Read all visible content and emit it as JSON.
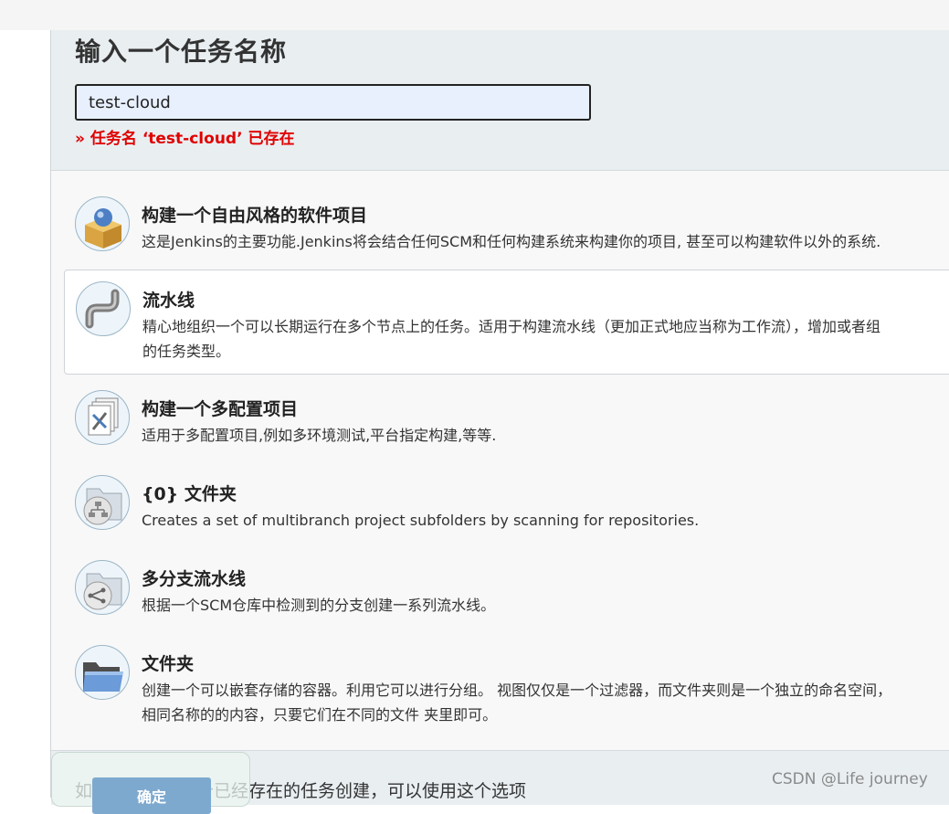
{
  "form": {
    "title": "输入一个任务名称",
    "name_value": "test-cloud",
    "error": "» 任务名 ‘test-cloud’ 已存在"
  },
  "item_types": [
    {
      "label": "构建一个自由风格的软件项目",
      "desc_lines": [
        "这是Jenkins的主要功能.Jenkins将会结合任何SCM和任何构建系统来构建你的项目, 甚至可以构建软件以外的系统."
      ],
      "icon": "freestyle-project-icon"
    },
    {
      "label": "流水线",
      "desc_lines": [
        "精心地组织一个可以长期运行在多个节点上的任务。适用于构建流水线（更加正式地应当称为工作流），增加或者组",
        "的任务类型。"
      ],
      "icon": "pipeline-icon",
      "selected": true
    },
    {
      "label": "构建一个多配置项目",
      "desc_lines": [
        "适用于多配置项目,例如多环境测试,平台指定构建,等等."
      ],
      "icon": "multi-config-project-icon"
    },
    {
      "label": "{0} 文件夹",
      "desc_lines": [
        "Creates a set of multibranch project subfolders by scanning for repositories."
      ],
      "icon": "org-folder-icon"
    },
    {
      "label": "多分支流水线",
      "desc_lines": [
        "根据一个SCM仓库中检测到的分支创建一系列流水线。"
      ],
      "icon": "multibranch-pipeline-icon"
    },
    {
      "label": "文件夹",
      "desc_lines": [
        "创建一个可以嵌套存储的容器。利用它可以进行分组。 视图仅仅是一个过滤器，而文件夹则是一个独立的命名空间，",
        "相同名称的的内容，只要它们在不同的文件 夹里即可。"
      ],
      "icon": "folder-icon"
    }
  ],
  "copy_hint": "如果你想根据一个已经存在的任务创建，可以使用这个选项",
  "ok_label": "确定",
  "watermark": "CSDN @Life  journey"
}
